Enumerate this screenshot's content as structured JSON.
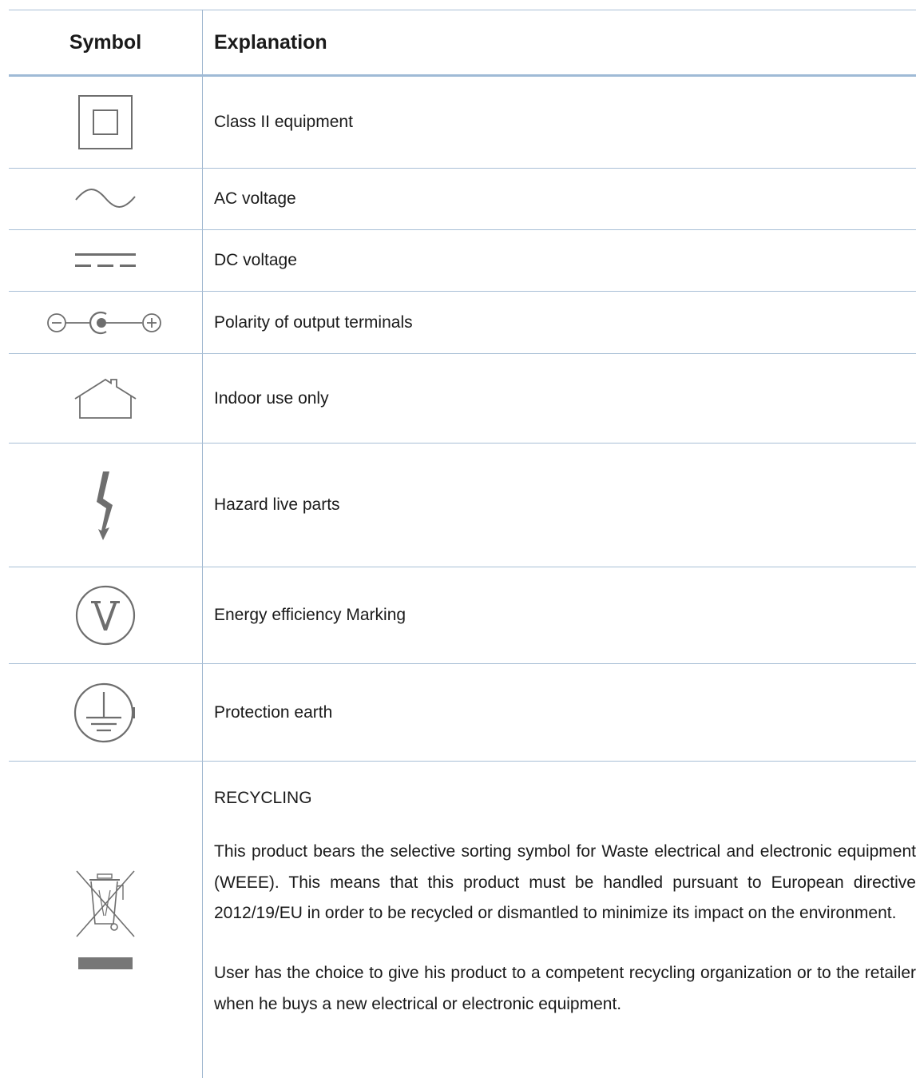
{
  "header": {
    "symbol": "Symbol",
    "explanation": "Explanation"
  },
  "rows": [
    {
      "icon": "class-ii-icon",
      "text": "Class II equipment"
    },
    {
      "icon": "ac-voltage-icon",
      "text": "AC voltage"
    },
    {
      "icon": "dc-voltage-icon",
      "text": "DC voltage"
    },
    {
      "icon": "polarity-icon",
      "text": "Polarity of output terminals"
    },
    {
      "icon": "house-icon",
      "text": "Indoor use only"
    },
    {
      "icon": "lightning-icon",
      "text": "Hazard live parts"
    },
    {
      "icon": "energy-v-icon",
      "text": "Energy efficiency Marking"
    },
    {
      "icon": "protective-earth-icon",
      "text": "Protection earth"
    }
  ],
  "recycling": {
    "icon": "weee-bin-icon",
    "title": "RECYCLING",
    "para1": "This product bears the selective sorting symbol for Waste electrical and electronic equipment (WEEE). This means that this product must be handled pursuant to European directive 2012/19/EU in order to be recycled or dismantled to minimize its impact on the environment.",
    "para2": "User has the choice to give his product to a competent recycling organization or to the retailer when he buys a new electrical or electronic equipment."
  }
}
